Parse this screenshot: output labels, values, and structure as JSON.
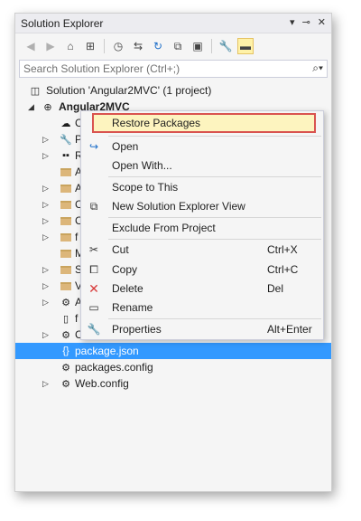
{
  "panel": {
    "title": "Solution Explorer",
    "controls": [
      "▾",
      "⊸",
      "✕"
    ]
  },
  "toolbar": {
    "icons": [
      "back-icon",
      "forward-icon",
      "home-icon",
      "switch-views-icon",
      "history-icon",
      "sync-icon",
      "refresh-icon",
      "collapse-all-icon",
      "show-all-files-icon",
      "properties-icon",
      "preview-icon"
    ]
  },
  "search": {
    "placeholder": "Search Solution Explorer (Ctrl+;)",
    "icon": "search-icon"
  },
  "tree": {
    "solution": "Solution 'Angular2MVC' (1 project)",
    "project": "Angular2MVC",
    "partial_items": [
      "C",
      "P",
      "R",
      "A",
      "A",
      "C",
      "C",
      "f",
      "M",
      "S",
      "V",
      "A",
      "f",
      "C"
    ],
    "items": [
      "package.json",
      "packages.config",
      "Web.config"
    ]
  },
  "context_menu": {
    "items": [
      {
        "label": "Restore Packages",
        "shortcut": "",
        "icon": ""
      },
      {
        "label": "Open",
        "shortcut": "",
        "icon": "open-icon"
      },
      {
        "label": "Open With...",
        "shortcut": "",
        "icon": ""
      },
      {
        "label": "Scope to This",
        "shortcut": "",
        "icon": ""
      },
      {
        "label": "New Solution Explorer View",
        "shortcut": "",
        "icon": "new-view-icon"
      },
      {
        "label": "Exclude From Project",
        "shortcut": "",
        "icon": ""
      },
      {
        "label": "Cut",
        "shortcut": "Ctrl+X",
        "icon": "cut-icon"
      },
      {
        "label": "Copy",
        "shortcut": "Ctrl+C",
        "icon": "copy-icon"
      },
      {
        "label": "Delete",
        "shortcut": "Del",
        "icon": "delete-icon"
      },
      {
        "label": "Rename",
        "shortcut": "",
        "icon": "rename-icon"
      },
      {
        "label": "Properties",
        "shortcut": "Alt+Enter",
        "icon": "properties-icon"
      }
    ]
  },
  "colors": {
    "selection": "#3399ff",
    "highlight_fill": "#fdf4bf",
    "highlight_border": "#d9534f",
    "delete_icon": "#d83b3b",
    "open_icon": "#1e6fc9"
  }
}
